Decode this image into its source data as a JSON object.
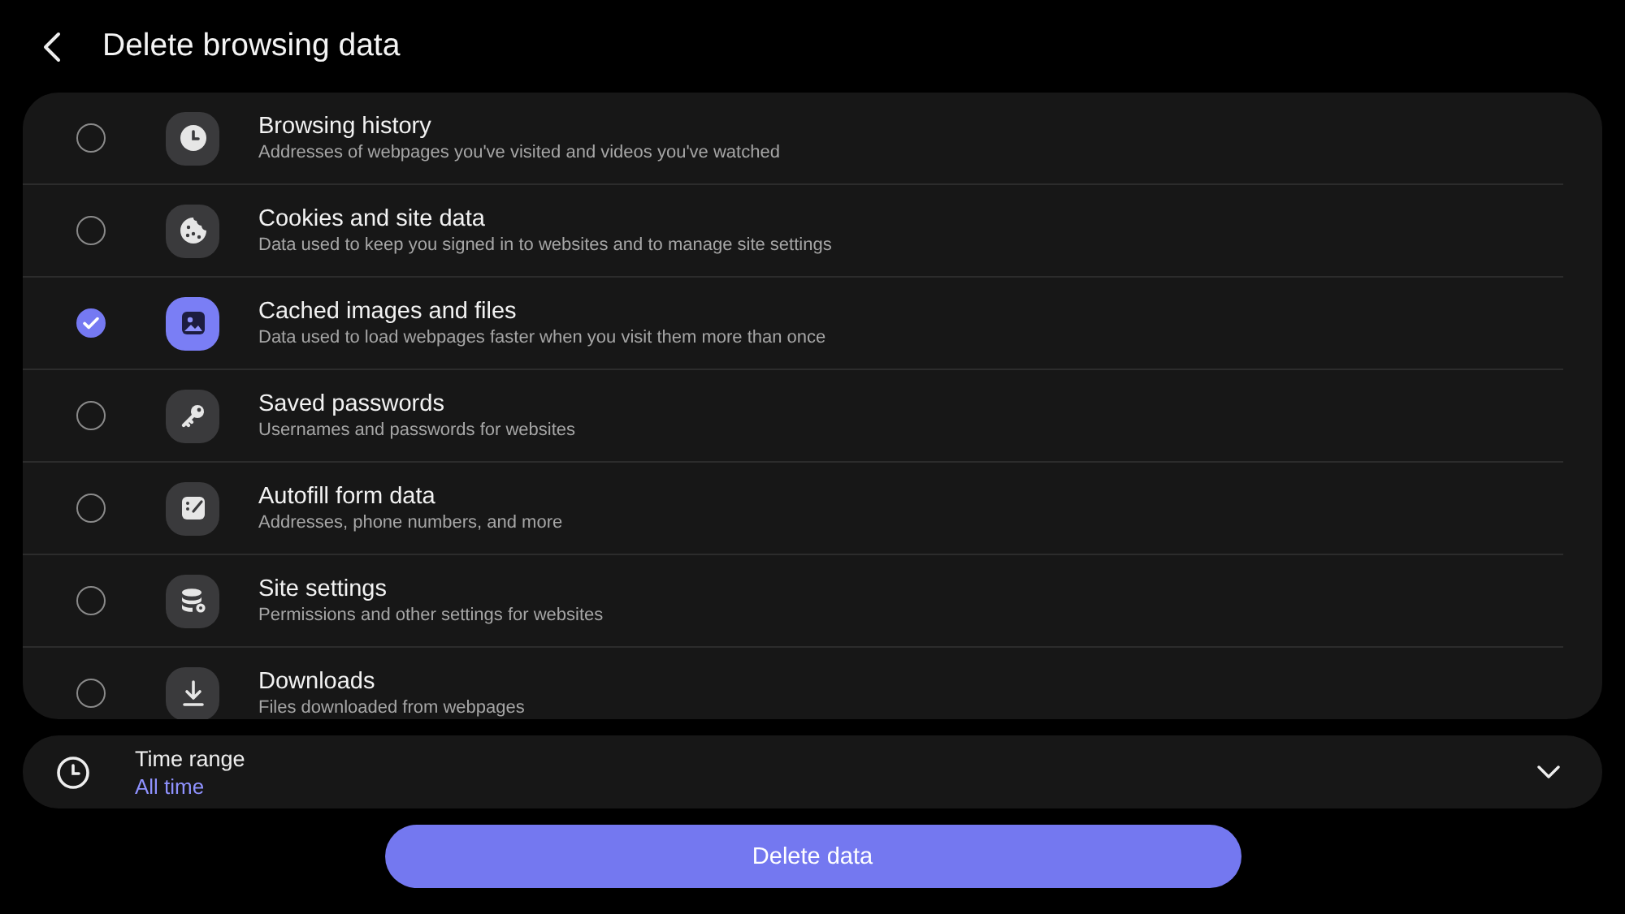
{
  "header": {
    "title": "Delete browsing data"
  },
  "options": [
    {
      "title": "Browsing history",
      "subtitle": "Addresses of webpages you've visited and videos you've watched",
      "kind": "clock",
      "checked": false
    },
    {
      "title": "Cookies and site data",
      "subtitle": "Data used to keep you signed in to websites and to manage site settings",
      "kind": "cookie",
      "checked": false
    },
    {
      "title": "Cached images and files",
      "subtitle": "Data used to load webpages faster when you visit them more than once",
      "kind": "image",
      "checked": true
    },
    {
      "title": "Saved passwords",
      "subtitle": "Usernames and passwords for websites",
      "kind": "key",
      "checked": false
    },
    {
      "title": "Autofill form data",
      "subtitle": "Addresses, phone numbers, and more",
      "kind": "autofill",
      "checked": false
    },
    {
      "title": "Site settings",
      "subtitle": "Permissions and other settings for websites",
      "kind": "database",
      "checked": false
    },
    {
      "title": "Downloads",
      "subtitle": "Files downloaded from webpages",
      "kind": "download",
      "checked": false
    }
  ],
  "time_range": {
    "label": "Time range",
    "value": "All time"
  },
  "button": {
    "label": "Delete data"
  }
}
